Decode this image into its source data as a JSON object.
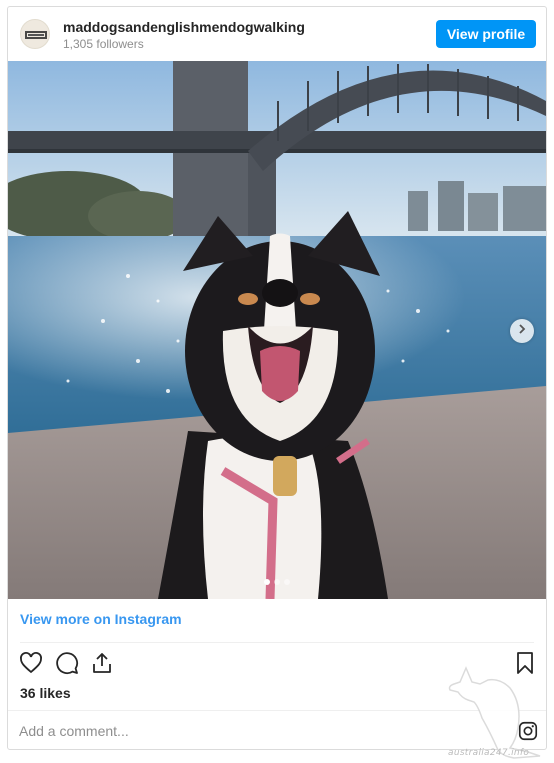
{
  "post": {
    "username": "maddogsandenglishmendogwalking",
    "followers": "1,305 followers",
    "view_profile_label": "View profile",
    "view_more_label": "View more on Instagram",
    "likes": "36 likes",
    "comment_placeholder": "Add a comment...",
    "carousel": {
      "total": 3,
      "current": 1
    }
  },
  "icons": {
    "avatar": "profile-avatar",
    "next": "chevron-right-icon",
    "like": "heart-icon",
    "comment": "comment-icon",
    "share": "share-icon",
    "save": "bookmark-icon",
    "instagram": "instagram-icon"
  },
  "watermark": {
    "text": "australia247.info"
  },
  "colors": {
    "accent": "#0095f6",
    "link": "#3897f0",
    "muted": "#8e8e8e"
  }
}
